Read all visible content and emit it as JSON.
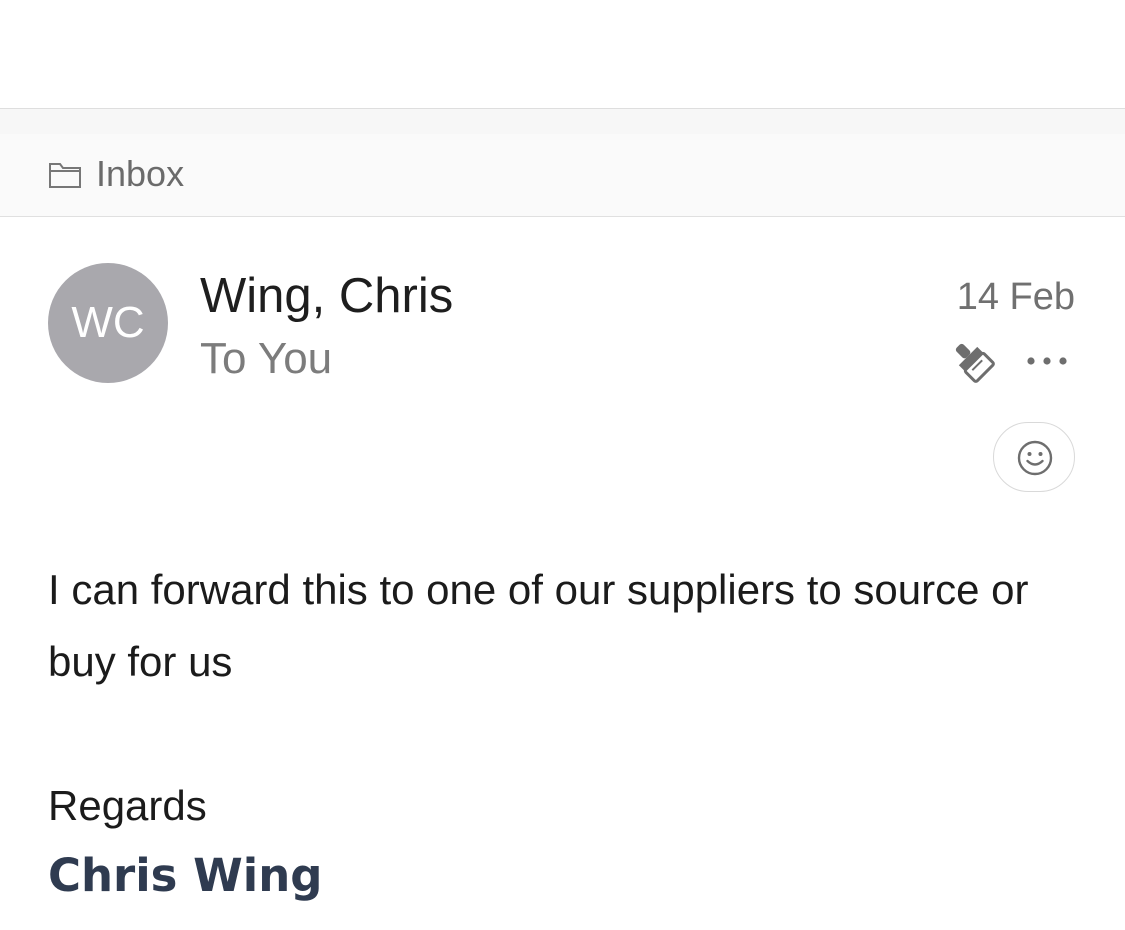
{
  "folder": {
    "label": "Inbox",
    "icon": "folder-icon"
  },
  "message": {
    "avatar_initials": "WC",
    "sender": "Wing, Chris",
    "recipient": "To You",
    "date": "14 Feb",
    "actions": {
      "brush_icon": "paintbrush-icon",
      "more_icon": "more-horizontal-icon",
      "reaction_icon": "smiley-icon"
    },
    "body": "I can forward this to one of our suppliers to source or buy for us",
    "closing": "Regards",
    "signature": "Chris Wing"
  },
  "colors": {
    "avatar_bg": "#a9a8ad",
    "signature": "#2f3b50",
    "secondary_text": "#7c7c7c"
  }
}
